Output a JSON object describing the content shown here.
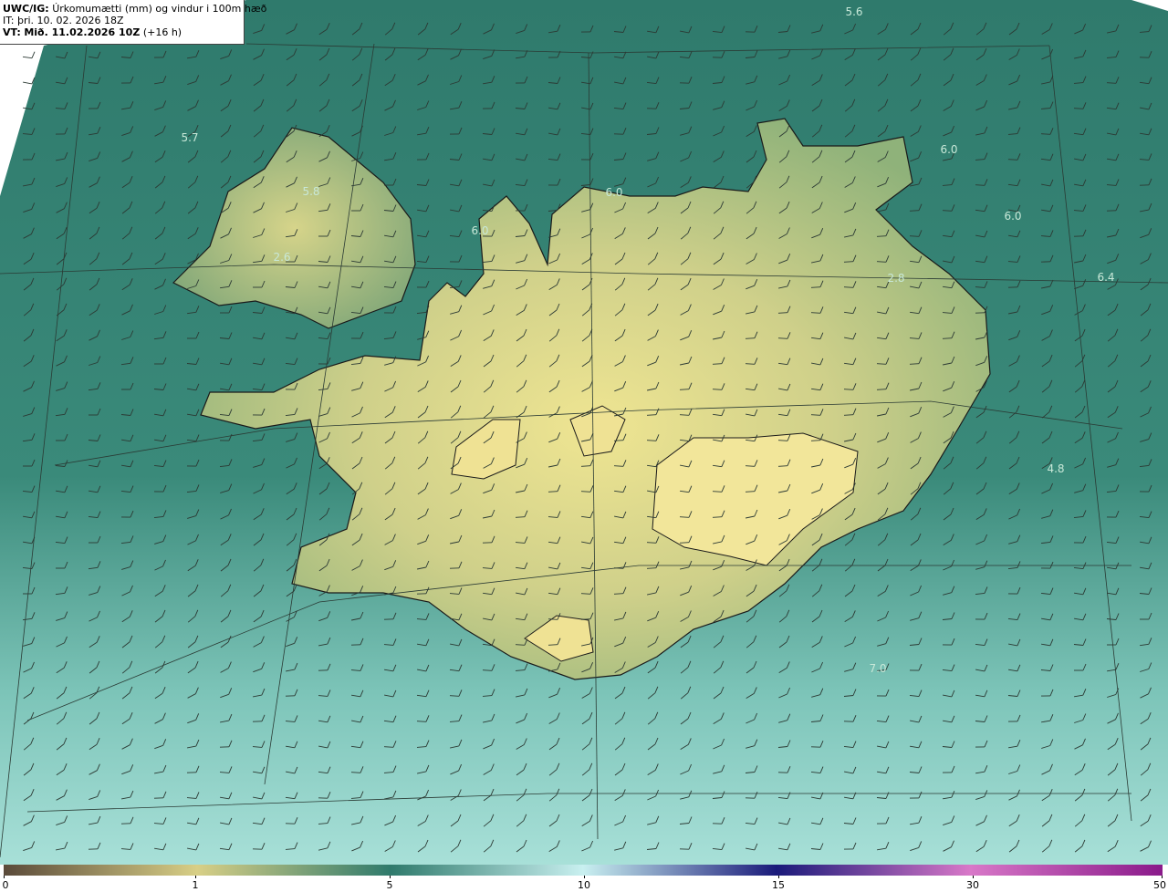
{
  "header": {
    "product": "UWC/IG:",
    "title": "Úrkomumætti (mm) og vindur i 100m hæð",
    "issue_time": "IT: þri. 10. 02. 2026 18Z",
    "valid_label": "VT:",
    "valid_time": "Mið. 11.02.2026 10Z",
    "lead": "(+16 h)"
  },
  "map": {
    "region": "Iceland",
    "colors": {
      "sea": "#2f7a6c",
      "land_low": "#9cba7c",
      "land_high": "#e8e08e",
      "coast": "#1a1a1a",
      "grid": "#2a3a34",
      "barb": "#2c3a34"
    }
  },
  "value_labels": [
    "5.6",
    "5.7",
    "5.8",
    "2.6",
    "6.0",
    "6.0",
    "6.0",
    "6.0",
    "2.8",
    "6.4",
    "4.8",
    "7.0"
  ],
  "colorbar": {
    "ticks": [
      "0",
      "1",
      "5",
      "10",
      "15",
      "30",
      "50"
    ],
    "stops": [
      "#5a4a3a",
      "#d8cf86",
      "#2f7a6c",
      "#c9f0f0",
      "#1a1a7a",
      "#d878c8",
      "#8a1a8a"
    ]
  }
}
